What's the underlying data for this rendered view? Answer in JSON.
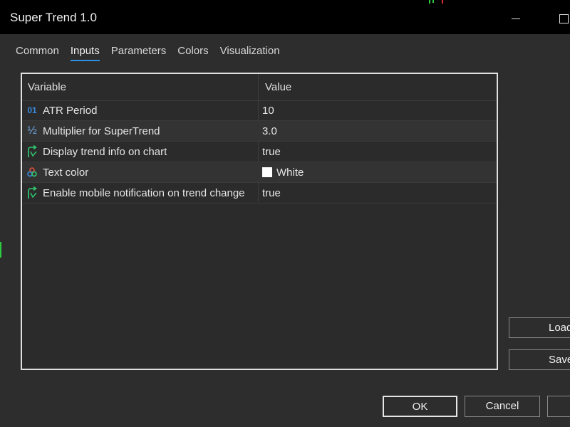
{
  "window": {
    "title": "Super Trend 1.0"
  },
  "tabs": [
    {
      "label": "Common"
    },
    {
      "label": "Inputs"
    },
    {
      "label": "Parameters"
    },
    {
      "label": "Colors"
    },
    {
      "label": "Visualization"
    }
  ],
  "active_tab": "Inputs",
  "table": {
    "headers": {
      "variable": "Variable",
      "value": "Value"
    },
    "rows": [
      {
        "icon": "integer-icon",
        "variable": "ATR Period",
        "value": "10"
      },
      {
        "icon": "fraction-icon",
        "variable": "Multiplier for SuperTrend",
        "value": "3.0"
      },
      {
        "icon": "boolean-arrow-icon",
        "variable": "Display trend info on chart",
        "value": "true"
      },
      {
        "icon": "color-palette-icon",
        "variable": "Text color",
        "value": "White",
        "swatch": "#ffffff"
      },
      {
        "icon": "boolean-arrow-icon",
        "variable": "Enable mobile notification on trend change",
        "value": "true"
      }
    ]
  },
  "buttons": {
    "load": "Load",
    "save": "Save",
    "ok": "OK",
    "cancel": "Cancel"
  },
  "colors": {
    "tab_underline": "#2f8fe0",
    "background": "#2d2d2d",
    "titlebar": "#000000"
  },
  "icons": {
    "integer_glyph": "01",
    "fraction_glyph": "½"
  }
}
